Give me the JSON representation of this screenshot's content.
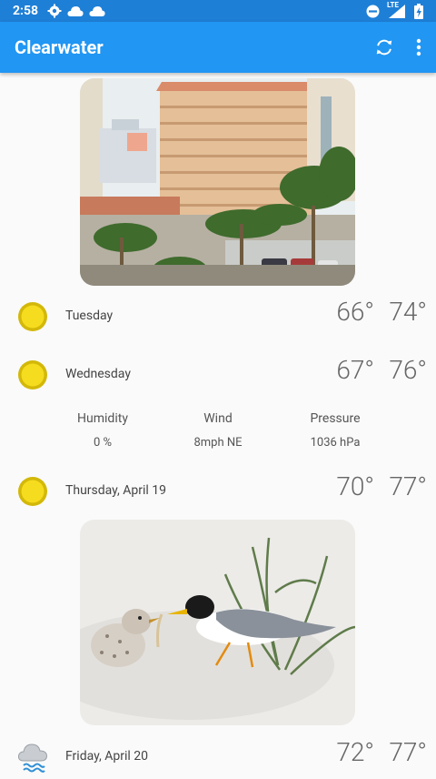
{
  "status_bar": {
    "time": "2:58",
    "network": "LTE"
  },
  "app_bar": {
    "title": "Clearwater"
  },
  "forecast": [
    {
      "day": "Tuesday",
      "low": "66°",
      "high": "74°",
      "icon": "sun-icon"
    },
    {
      "day": "Wednesday",
      "low": "67°",
      "high": "76°",
      "icon": "sun-icon"
    },
    {
      "day": "Thursday, April 19",
      "low": "70°",
      "high": "77°",
      "icon": "sun-icon"
    },
    {
      "day": "Friday, April 20",
      "low": "72°",
      "high": "77°",
      "icon": "rain-cloud-icon"
    }
  ],
  "details": {
    "humidity_label": "Humidity",
    "humidity_value": "0 %",
    "wind_label": "Wind",
    "wind_value": "8mph NE",
    "pressure_label": "Pressure",
    "pressure_value": "1036 hPa"
  },
  "colors": {
    "primary": "#2196f3",
    "status_bar": "#1e7fd6",
    "sun": "#f5d90a"
  }
}
